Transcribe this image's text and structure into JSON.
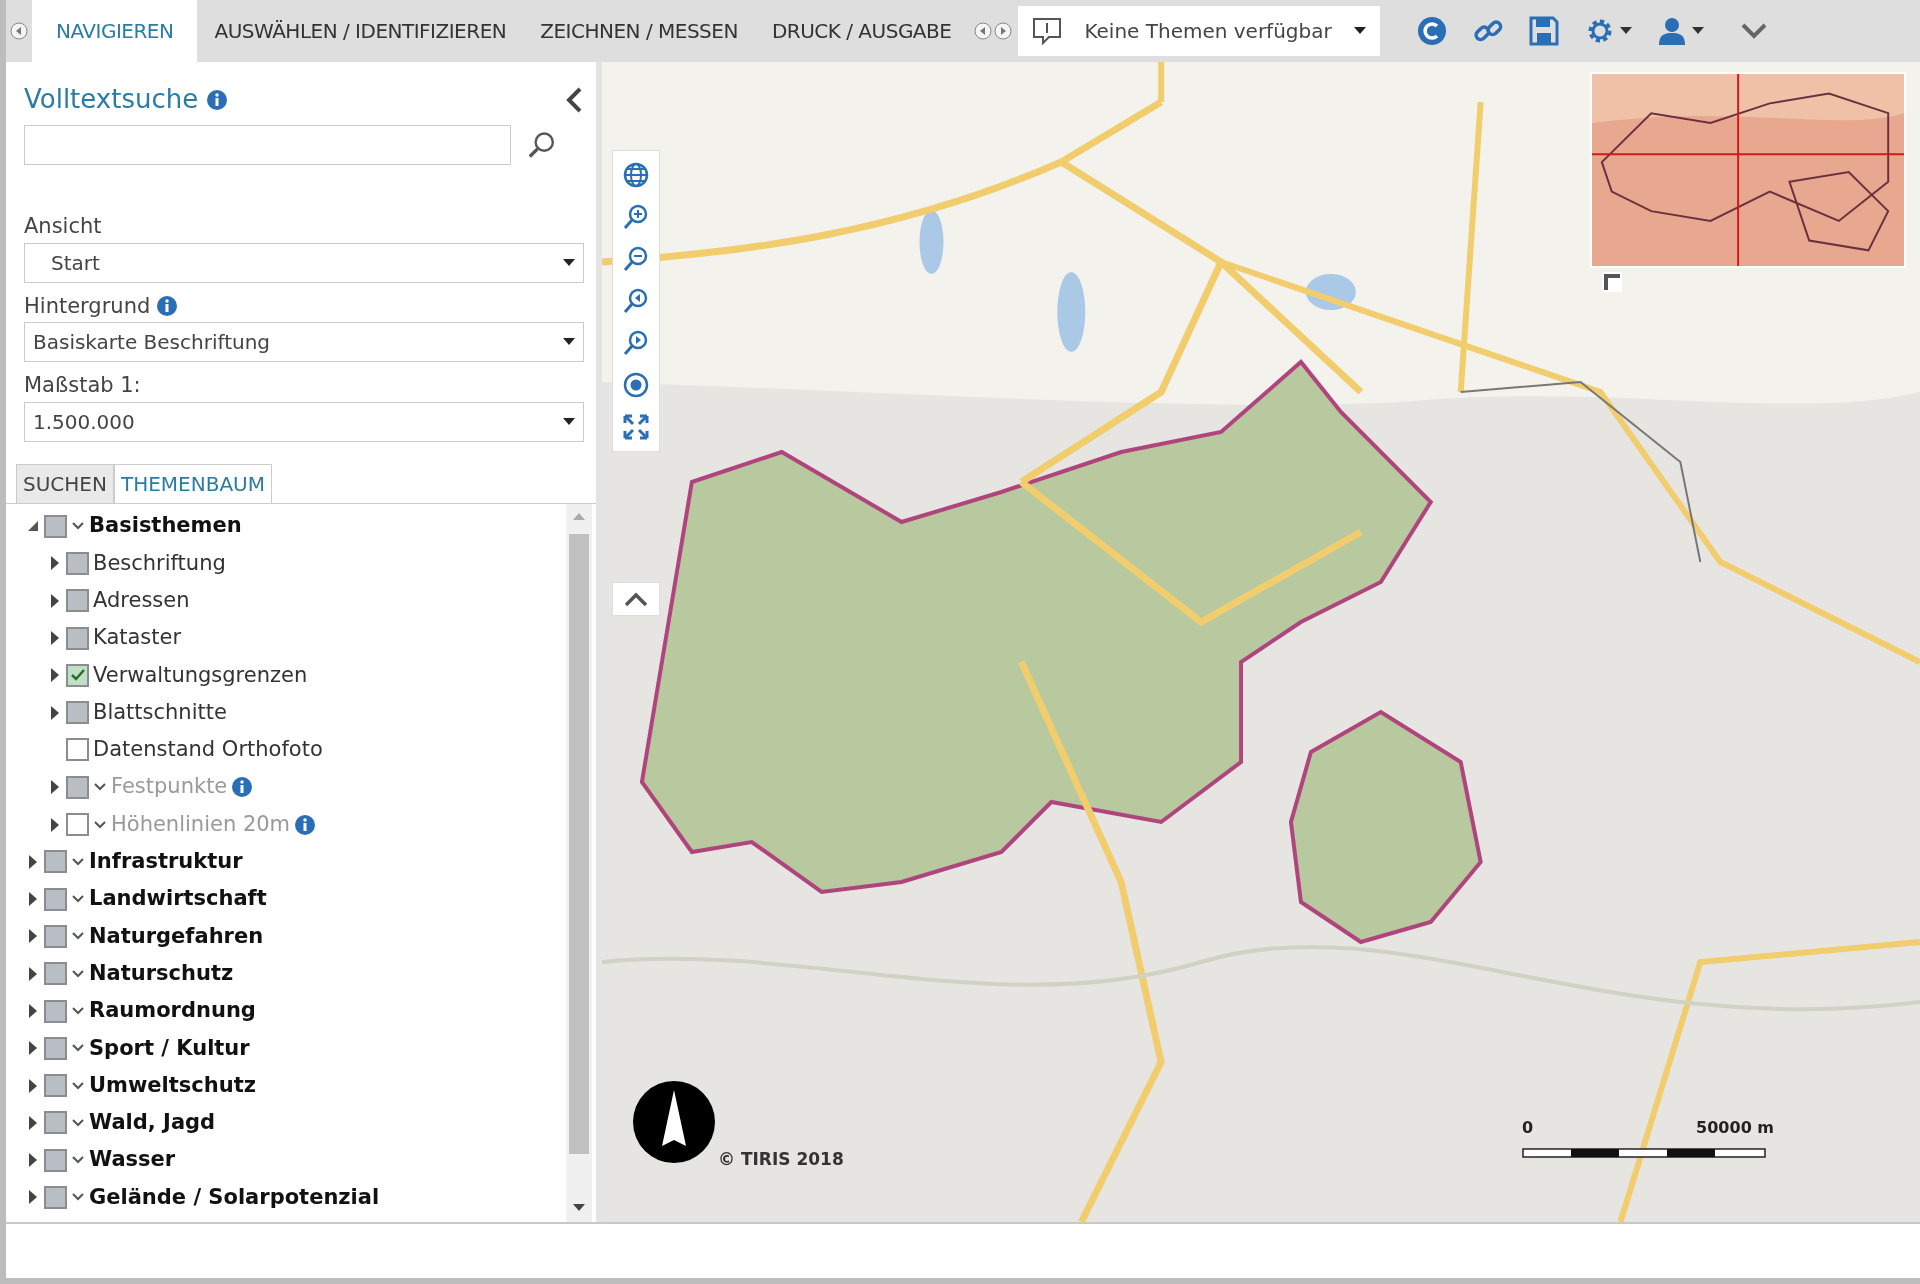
{
  "top_tabs": [
    {
      "label": "NAVIGIEREN",
      "selected": true
    },
    {
      "label": "AUSWÄHLEN / IDENTIFIZIEREN",
      "selected": false
    },
    {
      "label": "ZEICHNEN / MESSEN",
      "selected": false
    },
    {
      "label": "DRUCK / AUSGABE",
      "selected": false
    }
  ],
  "theme_select": {
    "value": "Keine Themen verfügbar"
  },
  "sidebar": {
    "search": {
      "title": "Volltextsuche"
    },
    "view": {
      "label": "Ansicht",
      "value": "Start"
    },
    "background": {
      "label": "Hintergrund",
      "value": "Basiskarte Beschriftung",
      "info": true
    },
    "scale": {
      "label": "Maßstab 1:",
      "value": "1.500.000"
    },
    "panel_tabs": [
      {
        "label": "SUCHEN",
        "selected": false
      },
      {
        "label": "THEMENBAUM",
        "selected": true
      }
    ],
    "tree": [
      {
        "label": "Basisthemen",
        "expandable": true,
        "expanded": true,
        "checked": false,
        "partial": true,
        "menu": true,
        "disabled": false,
        "info": false,
        "children": [
          {
            "label": "Beschriftung",
            "expandable": true,
            "checked": false,
            "partial": true,
            "menu": false,
            "disabled": false,
            "info": false
          },
          {
            "label": "Adressen",
            "expandable": true,
            "checked": false,
            "partial": true,
            "menu": false,
            "disabled": false,
            "info": false
          },
          {
            "label": "Kataster",
            "expandable": true,
            "checked": false,
            "partial": true,
            "menu": false,
            "disabled": false,
            "info": false
          },
          {
            "label": "Verwaltungsgrenzen",
            "expandable": true,
            "checked": true,
            "partial": false,
            "menu": false,
            "disabled": false,
            "info": false
          },
          {
            "label": "Blattschnitte",
            "expandable": true,
            "checked": false,
            "partial": true,
            "menu": false,
            "disabled": false,
            "info": false
          },
          {
            "label": "Datenstand Orthofoto",
            "expandable": false,
            "checked": false,
            "partial": false,
            "menu": false,
            "disabled": false,
            "info": false
          },
          {
            "label": "Festpunkte",
            "expandable": true,
            "checked": false,
            "partial": true,
            "menu": true,
            "disabled": true,
            "info": true
          },
          {
            "label": "Höhenlinien 20m",
            "expandable": true,
            "checked": false,
            "partial": false,
            "menu": true,
            "disabled": true,
            "info": true
          }
        ]
      },
      {
        "label": "Infrastruktur",
        "expandable": true,
        "expanded": false,
        "checked": false,
        "partial": true,
        "menu": true,
        "disabled": false,
        "info": false
      },
      {
        "label": "Landwirtschaft",
        "expandable": true,
        "expanded": false,
        "checked": false,
        "partial": true,
        "menu": true,
        "disabled": false,
        "info": false
      },
      {
        "label": "Naturgefahren",
        "expandable": true,
        "expanded": false,
        "checked": false,
        "partial": true,
        "menu": true,
        "disabled": false,
        "info": false
      },
      {
        "label": "Naturschutz",
        "expandable": true,
        "expanded": false,
        "checked": false,
        "partial": true,
        "menu": true,
        "disabled": false,
        "info": false
      },
      {
        "label": "Raumordnung",
        "expandable": true,
        "expanded": false,
        "checked": false,
        "partial": true,
        "menu": true,
        "disabled": false,
        "info": false
      },
      {
        "label": "Sport / Kultur",
        "expandable": true,
        "expanded": false,
        "checked": false,
        "partial": true,
        "menu": true,
        "disabled": false,
        "info": false
      },
      {
        "label": "Umweltschutz",
        "expandable": true,
        "expanded": false,
        "checked": false,
        "partial": true,
        "menu": true,
        "disabled": false,
        "info": false
      },
      {
        "label": "Wald, Jagd",
        "expandable": true,
        "expanded": false,
        "checked": false,
        "partial": true,
        "menu": true,
        "disabled": false,
        "info": false
      },
      {
        "label": "Wasser",
        "expandable": true,
        "expanded": false,
        "checked": false,
        "partial": true,
        "menu": true,
        "disabled": false,
        "info": false
      },
      {
        "label": "Gelände / Solarpotenzial",
        "expandable": true,
        "expanded": false,
        "checked": false,
        "partial": true,
        "menu": true,
        "disabled": false,
        "info": false
      }
    ]
  },
  "map": {
    "copyright": "© TIRIS 2018",
    "scale_bar": {
      "start": "0",
      "end": "50000 m"
    }
  }
}
